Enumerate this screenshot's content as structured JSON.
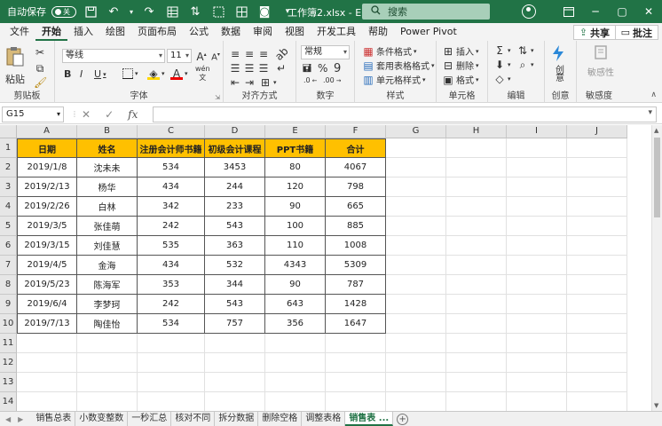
{
  "titlebar": {
    "autosave_label": "自动保存",
    "autosave_state": "关",
    "doc_title": "工作簿2.xlsx - E...",
    "search_placeholder": "搜索",
    "accent": "#217346",
    "minimize": "─",
    "restore": "▢",
    "close": "✕"
  },
  "ribbon_tabs": [
    "文件",
    "开始",
    "插入",
    "绘图",
    "页面布局",
    "公式",
    "数据",
    "审阅",
    "视图",
    "开发工具",
    "帮助",
    "Power Pivot"
  ],
  "active_tab": "开始",
  "share_label": "共享",
  "comment_label": "批注",
  "ribbon": {
    "clipboard": {
      "label": "剪贴板",
      "paste": "粘贴"
    },
    "font": {
      "label": "字体",
      "family": "等线",
      "size": "11"
    },
    "alignment": {
      "label": "对齐方式"
    },
    "number": {
      "label": "数字",
      "format": "常规"
    },
    "styles": {
      "label": "样式",
      "conditional": "条件格式",
      "table": "套用表格格式",
      "cell": "单元格样式"
    },
    "cells": {
      "label": "单元格",
      "insert": "插入",
      "delete": "删除",
      "format": "格式"
    },
    "editing": {
      "label": "编辑"
    },
    "ideas": {
      "label": "创意",
      "btn": "创意"
    },
    "sensitivity": {
      "label": "敏感度",
      "btn": "敏感性"
    }
  },
  "formula_bar": {
    "name_box": "G15",
    "fx": "fx",
    "value": ""
  },
  "columns": [
    "A",
    "B",
    "C",
    "D",
    "E",
    "F",
    "G",
    "H",
    "I",
    "J"
  ],
  "row_numbers": [
    "1",
    "2",
    "3",
    "4",
    "5",
    "6",
    "7",
    "8",
    "9",
    "10",
    "11",
    "12",
    "13",
    "14"
  ],
  "table": {
    "headers": [
      "日期",
      "姓名",
      "注册会计师书籍",
      "初级会计课程",
      "PPT书籍",
      "合计"
    ],
    "header_color": "#ffc000",
    "rows": [
      [
        "2019/1/8",
        "沈未未",
        "534",
        "3453",
        "80",
        "4067"
      ],
      [
        "2019/2/13",
        "杨华",
        "434",
        "244",
        "120",
        "798"
      ],
      [
        "2019/2/26",
        "白林",
        "342",
        "233",
        "90",
        "665"
      ],
      [
        "2019/3/5",
        "张佳萌",
        "242",
        "543",
        "100",
        "885"
      ],
      [
        "2019/3/15",
        "刘佳慧",
        "535",
        "363",
        "110",
        "1008"
      ],
      [
        "2019/4/5",
        "金海",
        "434",
        "532",
        "4343",
        "5309"
      ],
      [
        "2019/5/23",
        "陈海军",
        "353",
        "344",
        "90",
        "787"
      ],
      [
        "2019/6/4",
        "李梦珂",
        "242",
        "543",
        "643",
        "1428"
      ],
      [
        "2019/7/13",
        "陶佳怡",
        "534",
        "757",
        "356",
        "1647"
      ]
    ]
  },
  "sheet_tabs": [
    "销售总表",
    "小数变整数",
    "一秒汇总",
    "核对不同",
    "拆分数据",
    "删除空格",
    "调整表格",
    "销售表 ..."
  ],
  "active_sheet": "销售表 ..."
}
